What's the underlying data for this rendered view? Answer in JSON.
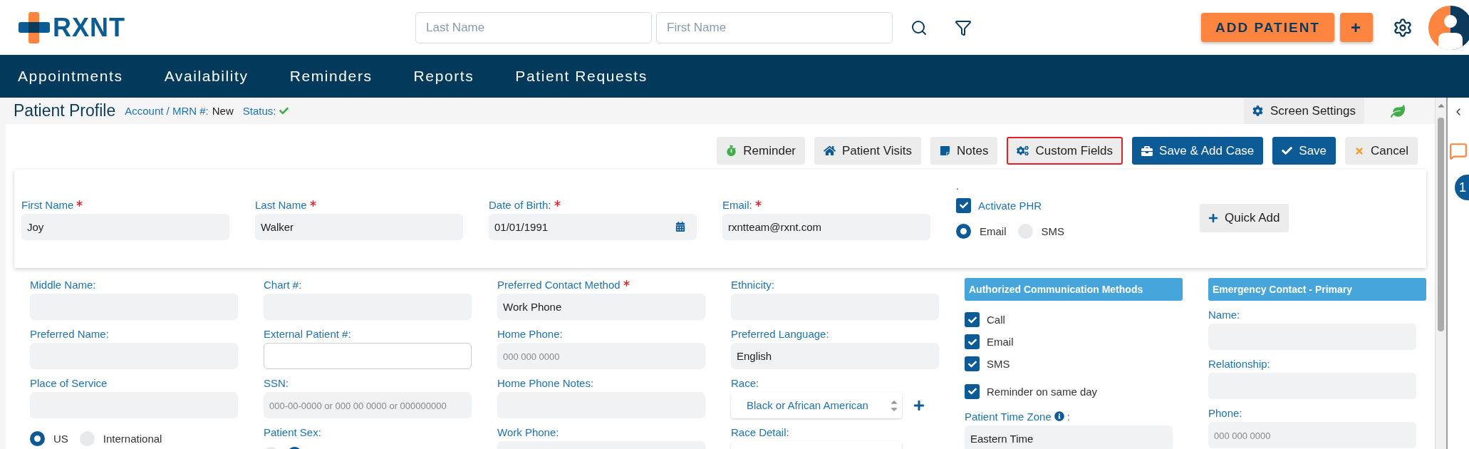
{
  "header": {
    "logo_text": "RXNT",
    "search_fields": [
      {
        "placeholder": "Last Name"
      },
      {
        "placeholder": "First Name"
      }
    ],
    "add_button": "ADD PATIENT",
    "plus_button": "+"
  },
  "nav": {
    "items": [
      {
        "label": "Appointments"
      },
      {
        "label": "Availability"
      },
      {
        "label": "Reminders"
      },
      {
        "label": "Reports"
      },
      {
        "label": "Patient Requests"
      }
    ]
  },
  "profile": {
    "title": "Patient Profile",
    "account_label": "Account / MRN #:",
    "account_value": "New",
    "status_label": "Status:",
    "status_ok": true,
    "screen_settings": "Screen Settings"
  },
  "toolbar": [
    {
      "label": "Reminder",
      "kind": "reminder",
      "highlighted": false
    },
    {
      "label": "Patient Visits",
      "kind": "visits",
      "highlighted": false
    },
    {
      "label": "Notes",
      "kind": "notes",
      "highlighted": false
    },
    {
      "label": "Custom Fields",
      "kind": "custom",
      "highlighted": true
    },
    {
      "label": "Save & Add Case",
      "kind": "case",
      "highlighted": false
    },
    {
      "label": "Save",
      "kind": "save",
      "highlighted": false
    },
    {
      "label": "Cancel",
      "kind": "cancel",
      "highlighted": false
    }
  ],
  "top_fields": [
    {
      "kind": "field",
      "label": "First Name",
      "required": true,
      "value": "Joy"
    },
    {
      "kind": "field",
      "label": "Last Name",
      "required": true,
      "value": "Walker"
    },
    {
      "kind": "date",
      "label": "Date of Birth:",
      "required": true,
      "value": "01/01/1991"
    },
    {
      "kind": "field",
      "label": "Email:",
      "required": true,
      "value": "rxntteam@rxnt.com"
    }
  ],
  "phr": {
    "mark": ".",
    "label": "Activate PHR",
    "checked": true,
    "options": [
      {
        "label": "Email",
        "selected": true
      },
      {
        "label": "SMS",
        "selected": false
      }
    ]
  },
  "quick_add": "Quick Add",
  "columns": [
    [
      {
        "kind": "field",
        "label": "Middle Name:",
        "required": false
      },
      {
        "kind": "field",
        "label": "Preferred Name:",
        "required": false
      },
      {
        "kind": "field",
        "label": "Place of Service",
        "required": false
      },
      {
        "kind": "radios",
        "options": [
          {
            "label": "US",
            "selected": true
          },
          {
            "label": "International",
            "selected": false
          }
        ]
      }
    ],
    [
      {
        "kind": "field",
        "label": "Chart #:",
        "required": false
      },
      {
        "kind": "input",
        "label": "External Patient #:",
        "required": false
      },
      {
        "kind": "field",
        "label": "SSN:",
        "required": false,
        "placeholder": "000-00-0000 or 000 00 0000 or 000000000"
      },
      {
        "kind": "radios",
        "label": "Patient Sex:",
        "options": [
          {
            "selected": false
          },
          {
            "selected": true
          }
        ]
      }
    ],
    [
      {
        "kind": "field",
        "label": "Preferred Contact Method",
        "required": true,
        "value": "Work Phone"
      },
      {
        "kind": "field",
        "label": "Home Phone:",
        "required": false,
        "placeholder": "000 000 0000"
      },
      {
        "kind": "field",
        "label": "Home Phone Notes:",
        "required": false
      },
      {
        "kind": "field",
        "label": "Work Phone:",
        "required": false
      }
    ],
    [
      {
        "kind": "field",
        "label": "Ethnicity:",
        "required": false
      },
      {
        "kind": "field",
        "label": "Preferred Language:",
        "required": false,
        "value": "English"
      },
      {
        "kind": "list",
        "label": "Race:",
        "required": false,
        "value": "Black or African American"
      },
      {
        "kind": "list",
        "label": "Race Detail:",
        "required": false
      }
    ]
  ],
  "communication": {
    "title": "Authorized Communication Methods",
    "methods": [
      {
        "label": "Call",
        "checked": true
      },
      {
        "label": "Email",
        "checked": true
      },
      {
        "label": "SMS",
        "checked": true
      },
      {
        "label": "Reminder on same day",
        "checked": true
      }
    ],
    "time_zone": {
      "label": "Patient Time Zone",
      "suffix": ":",
      "value": "Eastern Time"
    }
  },
  "emergency": {
    "title": "Emergency Contact - Primary",
    "fields": [
      {
        "label": "Name:"
      },
      {
        "label": "Relationship:"
      },
      {
        "label": "Phone:",
        "placeholder": "000 000 0000"
      }
    ]
  },
  "rail": {
    "badge": "1"
  }
}
